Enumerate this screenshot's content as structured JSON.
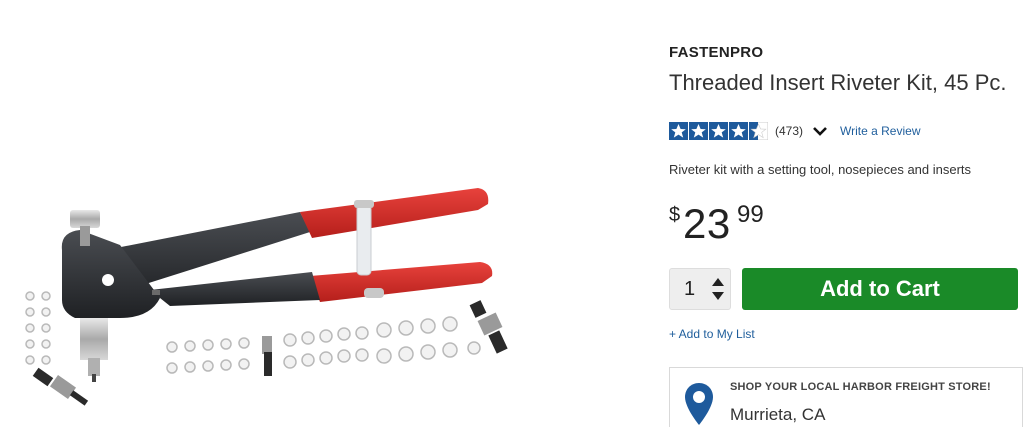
{
  "product": {
    "brand": "FASTENPRO",
    "title": "Threaded Insert Riveter Kit, 45 Pc.",
    "rating": 4.5,
    "review_count": "(473)",
    "write_review_label": "Write a Review",
    "description": "Riveter kit with a setting tool, nosepieces and inserts",
    "price": {
      "currency": "$",
      "dollars": "23",
      "cents": "99"
    },
    "quantity": "1",
    "add_to_cart_label": "Add to Cart",
    "add_to_list_label": "+ Add to My List",
    "image_alt_icon": "riveter-kit-photo"
  },
  "store": {
    "heading": "SHOP YOUR LOCAL HARBOR FREIGHT STORE!",
    "city": "Murrieta, CA",
    "icon": "map-pin-icon"
  },
  "colors": {
    "accent_green": "#1a8a28",
    "link_blue": "#1f5e9c",
    "star_blue": "#1e5a9c",
    "handle_red": "#d92b2b"
  }
}
